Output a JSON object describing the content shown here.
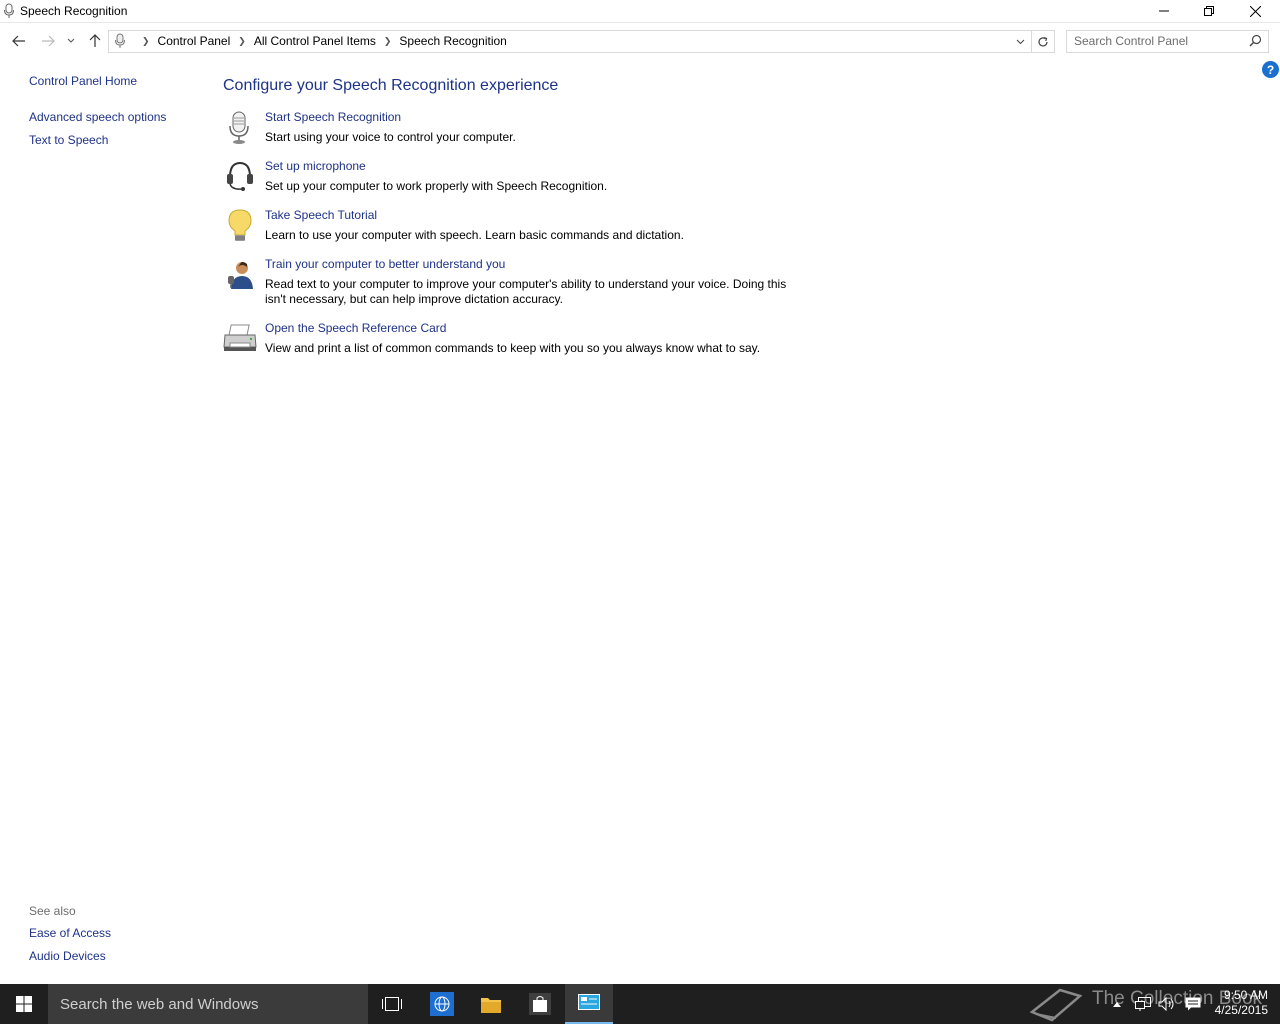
{
  "window": {
    "title": "Speech Recognition"
  },
  "address": {
    "crumbs": [
      "Control Panel",
      "All Control Panel Items",
      "Speech Recognition"
    ],
    "search_placeholder": "Search Control Panel"
  },
  "sidebar": {
    "home": "Control Panel Home",
    "links": [
      "Advanced speech options",
      "Text to Speech"
    ],
    "see_also_label": "See also",
    "see_also": [
      "Ease of Access",
      "Audio Devices"
    ]
  },
  "main": {
    "title": "Configure your Speech Recognition experience",
    "tasks": [
      {
        "icon": "microphone-icon",
        "link": "Start Speech Recognition",
        "desc": "Start using your voice to control your computer."
      },
      {
        "icon": "headset-icon",
        "link": "Set up microphone",
        "desc": "Set up your computer to work properly with Speech Recognition."
      },
      {
        "icon": "lightbulb-icon",
        "link": "Take Speech Tutorial",
        "desc": "Learn to use your computer with speech.  Learn basic commands and dictation."
      },
      {
        "icon": "user-train-icon",
        "link": "Train your computer to better understand you",
        "desc": "Read text to your computer to improve your computer's ability to understand your voice.  Doing this isn't necessary, but can help improve dictation accuracy."
      },
      {
        "icon": "printer-icon",
        "link": "Open the Speech Reference Card",
        "desc": "View and print a list of common commands to keep with you so you always know what to say."
      }
    ]
  },
  "taskbar": {
    "search_text": "Search the web and Windows",
    "watermark": "The Collection Book",
    "time": "9:50 AM",
    "date": "4/25/2015"
  },
  "colors": {
    "link": "#1e3287",
    "taskbar": "#1f1f1f",
    "accent": "#76b9ed"
  }
}
